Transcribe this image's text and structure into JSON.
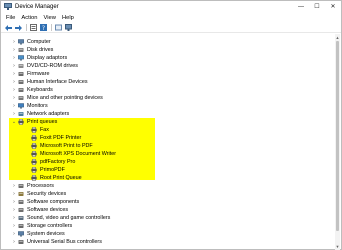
{
  "window": {
    "title": "Device Manager",
    "controls": {
      "minimize": "—",
      "maximize": "☐",
      "close": "✕"
    }
  },
  "menu": [
    "File",
    "Action",
    "View",
    "Help"
  ],
  "toolbar": [
    "back-arrow-icon",
    "forward-arrow-icon",
    "properties-icon",
    "help-icon",
    "refresh-icon",
    "monitor-icon"
  ],
  "tree": {
    "expander_collapsed": "›",
    "expander_expanded": "⌄",
    "items": [
      {
        "label": "Computer",
        "icon": "computer-icon",
        "expanded": false,
        "color": "#5b7fa6"
      },
      {
        "label": "Disk drives",
        "icon": "disk-drive-icon",
        "expanded": false,
        "color": "#7c7c7c"
      },
      {
        "label": "Display adaptors",
        "icon": "display-adapter-icon",
        "expanded": false,
        "color": "#4a90c8"
      },
      {
        "label": "DVD/CD-ROM drives",
        "icon": "dvd-drive-icon",
        "expanded": false,
        "color": "#8a8a8a"
      },
      {
        "label": "Firmware",
        "icon": "firmware-icon",
        "expanded": false,
        "color": "#6b6b6b"
      },
      {
        "label": "Human Interface Devices",
        "icon": "hid-icon",
        "expanded": false,
        "color": "#6f6f6f"
      },
      {
        "label": "Keyboards",
        "icon": "keyboard-icon",
        "expanded": false,
        "color": "#707070"
      },
      {
        "label": "Mice and other pointing devices",
        "icon": "mouse-icon",
        "expanded": false,
        "color": "#777777"
      },
      {
        "label": "Monitors",
        "icon": "monitor-icon",
        "expanded": false,
        "color": "#3f7fbf"
      },
      {
        "label": "Network adapters",
        "icon": "network-adapter-icon",
        "expanded": false,
        "color": "#4c7d9e"
      },
      {
        "label": "Print queues",
        "icon": "printer-icon",
        "expanded": true,
        "color": "#555555"
      },
      {
        "label": "Fax",
        "icon": "printer-icon",
        "child": true,
        "color": "#555555"
      },
      {
        "label": "Foxit PDF Printer",
        "icon": "printer-icon",
        "child": true,
        "color": "#555555"
      },
      {
        "label": "Microsoft Print to PDF",
        "icon": "printer-icon",
        "child": true,
        "color": "#555555"
      },
      {
        "label": "Microsoft XPS Document Writer",
        "icon": "printer-icon",
        "child": true,
        "color": "#555555"
      },
      {
        "label": "pdfFactory Pro",
        "icon": "printer-icon",
        "child": true,
        "color": "#555555"
      },
      {
        "label": "PrimoPDF",
        "icon": "printer-icon",
        "child": true,
        "color": "#555555"
      },
      {
        "label": "Root Print Queue",
        "icon": "printer-icon",
        "child": true,
        "color": "#555555"
      },
      {
        "label": "Processors",
        "icon": "processor-icon",
        "expanded": false,
        "color": "#6d6d6d"
      },
      {
        "label": "Security devices",
        "icon": "security-device-icon",
        "expanded": false,
        "color": "#8c7a3f"
      },
      {
        "label": "Software components",
        "icon": "software-component-icon",
        "expanded": false,
        "color": "#6f6f6f"
      },
      {
        "label": "Software devices",
        "icon": "software-device-icon",
        "expanded": false,
        "color": "#6f6f6f"
      },
      {
        "label": "Sound, video and game controllers",
        "icon": "sound-icon",
        "expanded": false,
        "color": "#5c6f80"
      },
      {
        "label": "Storage controllers",
        "icon": "storage-controller-icon",
        "expanded": false,
        "color": "#6a6a6a"
      },
      {
        "label": "System devices",
        "icon": "system-device-icon",
        "expanded": false,
        "color": "#5b7fa6"
      },
      {
        "label": "Universal Serial Bus controllers",
        "icon": "usb-icon",
        "expanded": false,
        "color": "#6a6a6a"
      }
    ]
  },
  "highlight_color": "#ffff00"
}
